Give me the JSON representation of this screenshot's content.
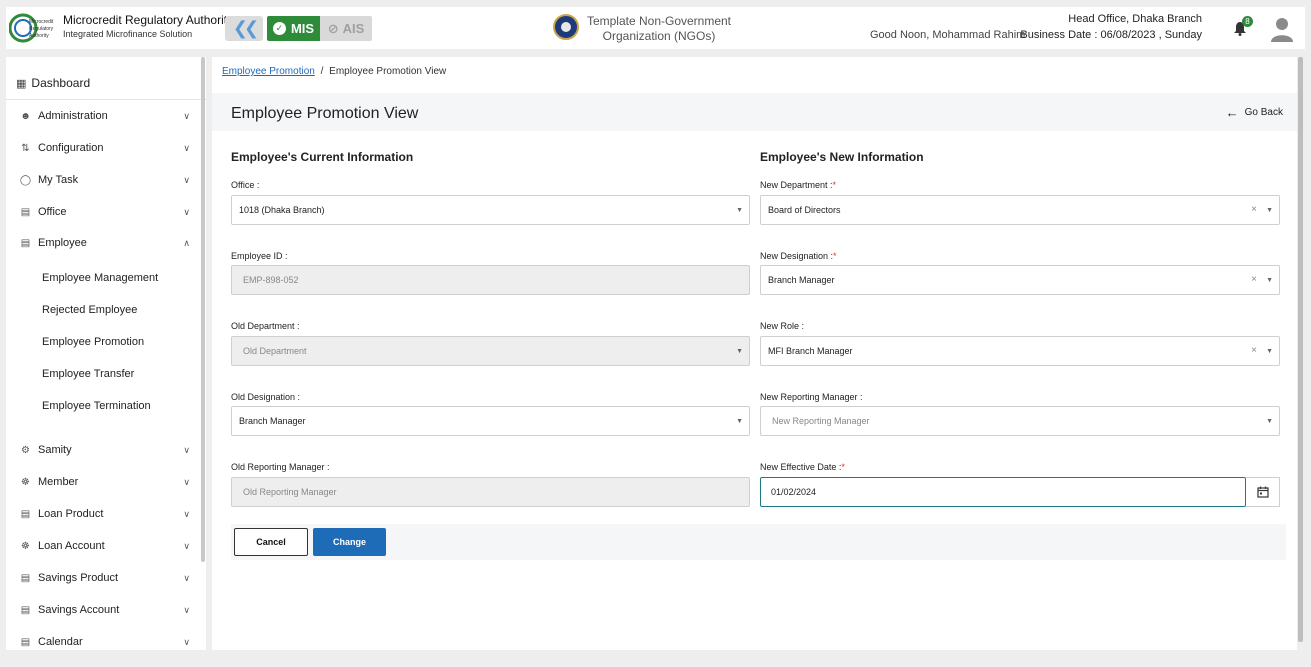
{
  "header": {
    "org_name": "Microcredit Regulatory Authority",
    "org_subtitle": "Integrated Microfinance Solution",
    "logo_text": "Microcredit Regulatory Authority",
    "mis_label": "MIS",
    "ais_label": "AIS",
    "ngo_line1": "Template Non-Government",
    "ngo_line2": "Organization (NGOs)",
    "greeting": "Good Noon, Mohammad Rahim",
    "branch": "Head Office, Dhaka Branch",
    "business_date": "Business Date : 06/08/2023 , Sunday",
    "notification_count": "8",
    "accent_green": "#2e8b3a",
    "accent_blue": "#1e6bb8"
  },
  "sidebar": {
    "dashboard": "Dashboard",
    "items": [
      {
        "label": "Administration",
        "icon": "admin-icon"
      },
      {
        "label": "Configuration",
        "icon": "config-icon"
      },
      {
        "label": "My Task",
        "icon": "task-icon"
      },
      {
        "label": "Office",
        "icon": "office-icon"
      },
      {
        "label": "Employee",
        "icon": "employee-icon"
      },
      {
        "label": "Samity",
        "icon": "samity-icon"
      },
      {
        "label": "Member",
        "icon": "member-icon"
      },
      {
        "label": "Loan Product",
        "icon": "loan-product-icon"
      },
      {
        "label": "Loan Account",
        "icon": "loan-account-icon"
      },
      {
        "label": "Savings Product",
        "icon": "savings-product-icon"
      },
      {
        "label": "Savings Account",
        "icon": "savings-account-icon"
      },
      {
        "label": "Calendar",
        "icon": "calendar-icon"
      }
    ],
    "employee_sub": [
      "Employee Management",
      "Rejected Employee",
      "Employee Promotion",
      "Employee Transfer",
      "Employee Termination"
    ]
  },
  "breadcrumb": {
    "link": "Employee Promotion",
    "separator": "/",
    "current": "Employee Promotion View"
  },
  "page": {
    "title": "Employee Promotion View",
    "go_back": "Go Back"
  },
  "current": {
    "title": "Employee's Current Information",
    "office_label": "Office :",
    "office_value": "1018 (Dhaka Branch)",
    "emp_id_label": "Employee ID :",
    "emp_id_value": "EMP-898-052",
    "old_dept_label": "Old Department :",
    "old_dept_placeholder": "Old Department",
    "old_desig_label": "Old Designation :",
    "old_desig_value": "Branch Manager",
    "old_mgr_label": "Old Reporting Manager :",
    "old_mgr_placeholder": "Old Reporting Manager"
  },
  "new": {
    "title": "Employee's New Information",
    "dept_label": "New Department :",
    "dept_value": "Board of Directors",
    "desig_label": "New Designation :",
    "desig_value": "Branch Manager",
    "role_label": "New Role :",
    "role_value": "MFI Branch Manager",
    "mgr_label": "New Reporting Manager :",
    "mgr_placeholder": "New Reporting Manager",
    "date_label": "New Effective Date :",
    "date_value": "01/02/2024",
    "required_mark": "*"
  },
  "actions": {
    "cancel": "Cancel",
    "change": "Change"
  }
}
